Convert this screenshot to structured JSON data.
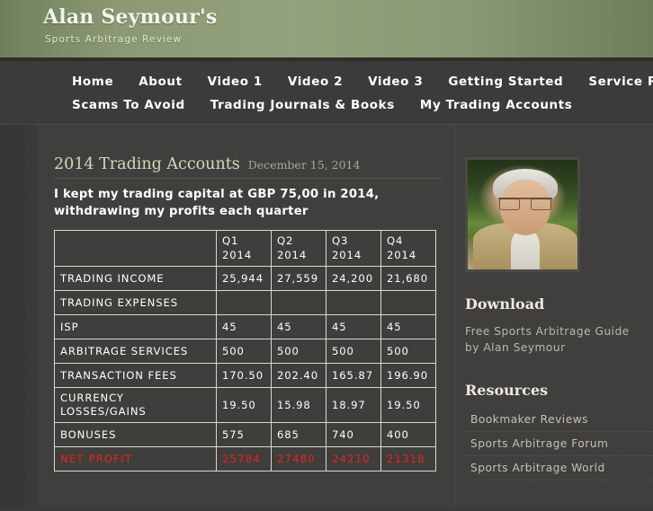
{
  "header": {
    "title": "Alan Seymour's",
    "tagline": "Sports Arbitrage Review"
  },
  "nav": {
    "row1": [
      "Home",
      "About",
      "Video 1",
      "Video 2",
      "Video 3",
      "Getting Started",
      "Service Reviews"
    ],
    "row2": [
      "Scams To Avoid",
      "Trading Journals & Books",
      "My Trading Accounts"
    ]
  },
  "post": {
    "title": "2014 Trading Accounts",
    "date": "December 15, 2014",
    "lede": "I kept my trading capital at  GBP 75,00 in 2014, withdrawing my profits each quarter"
  },
  "table": {
    "corner": "",
    "columns": [
      {
        "quarter": "Q1",
        "year": "2014"
      },
      {
        "quarter": "Q2",
        "year": "2014"
      },
      {
        "quarter": "Q3",
        "year": "2014"
      },
      {
        "quarter": "Q4",
        "year": "2014"
      }
    ],
    "rows": [
      {
        "label": "TRADING INCOME",
        "values": [
          "25,944",
          "27,559",
          "24,200",
          "21,680"
        ],
        "style": "normal"
      },
      {
        "label": "TRADING EXPENSES",
        "values": [
          "",
          "",
          "",
          ""
        ],
        "style": "normal"
      },
      {
        "label": "ISP",
        "values": [
          "45",
          "45",
          "45",
          "45"
        ],
        "style": "normal"
      },
      {
        "label": "ARBITRAGE SERVICES",
        "values": [
          "500",
          "500",
          "500",
          "500"
        ],
        "style": "normal"
      },
      {
        "label": "TRANSACTION FEES",
        "values": [
          "170.50",
          "202.40",
          "165.87",
          "196.90"
        ],
        "style": "normal"
      },
      {
        "label": "CURRENCY\nLOSSES/GAINS",
        "values": [
          "19.50",
          "15.98",
          "18.97",
          "19.50"
        ],
        "style": "twoline"
      },
      {
        "label": "BONUSES",
        "values": [
          "575",
          "685",
          "740",
          "400"
        ],
        "style": "normal"
      },
      {
        "label": "NET PROFIT",
        "values": [
          "25784",
          "27480",
          "24210",
          "21318"
        ],
        "style": "netprofit"
      }
    ]
  },
  "sidebar": {
    "download_heading": "Download",
    "download_text": "Free Sports Arbitrage Guide by Alan Seymour",
    "resources_heading": "Resources",
    "resource_links": [
      "Bookmaker Reviews",
      "Sports Arbitrage Forum",
      "Sports Arbitrage World"
    ]
  },
  "colors": {
    "banner_green": "#8b9a74",
    "page_dark": "#3a3a38",
    "panel": "#403f3d",
    "title_cream": "#d6d7bf",
    "net_profit_red": "#e8231b",
    "table_border": "#d8d8d0"
  }
}
